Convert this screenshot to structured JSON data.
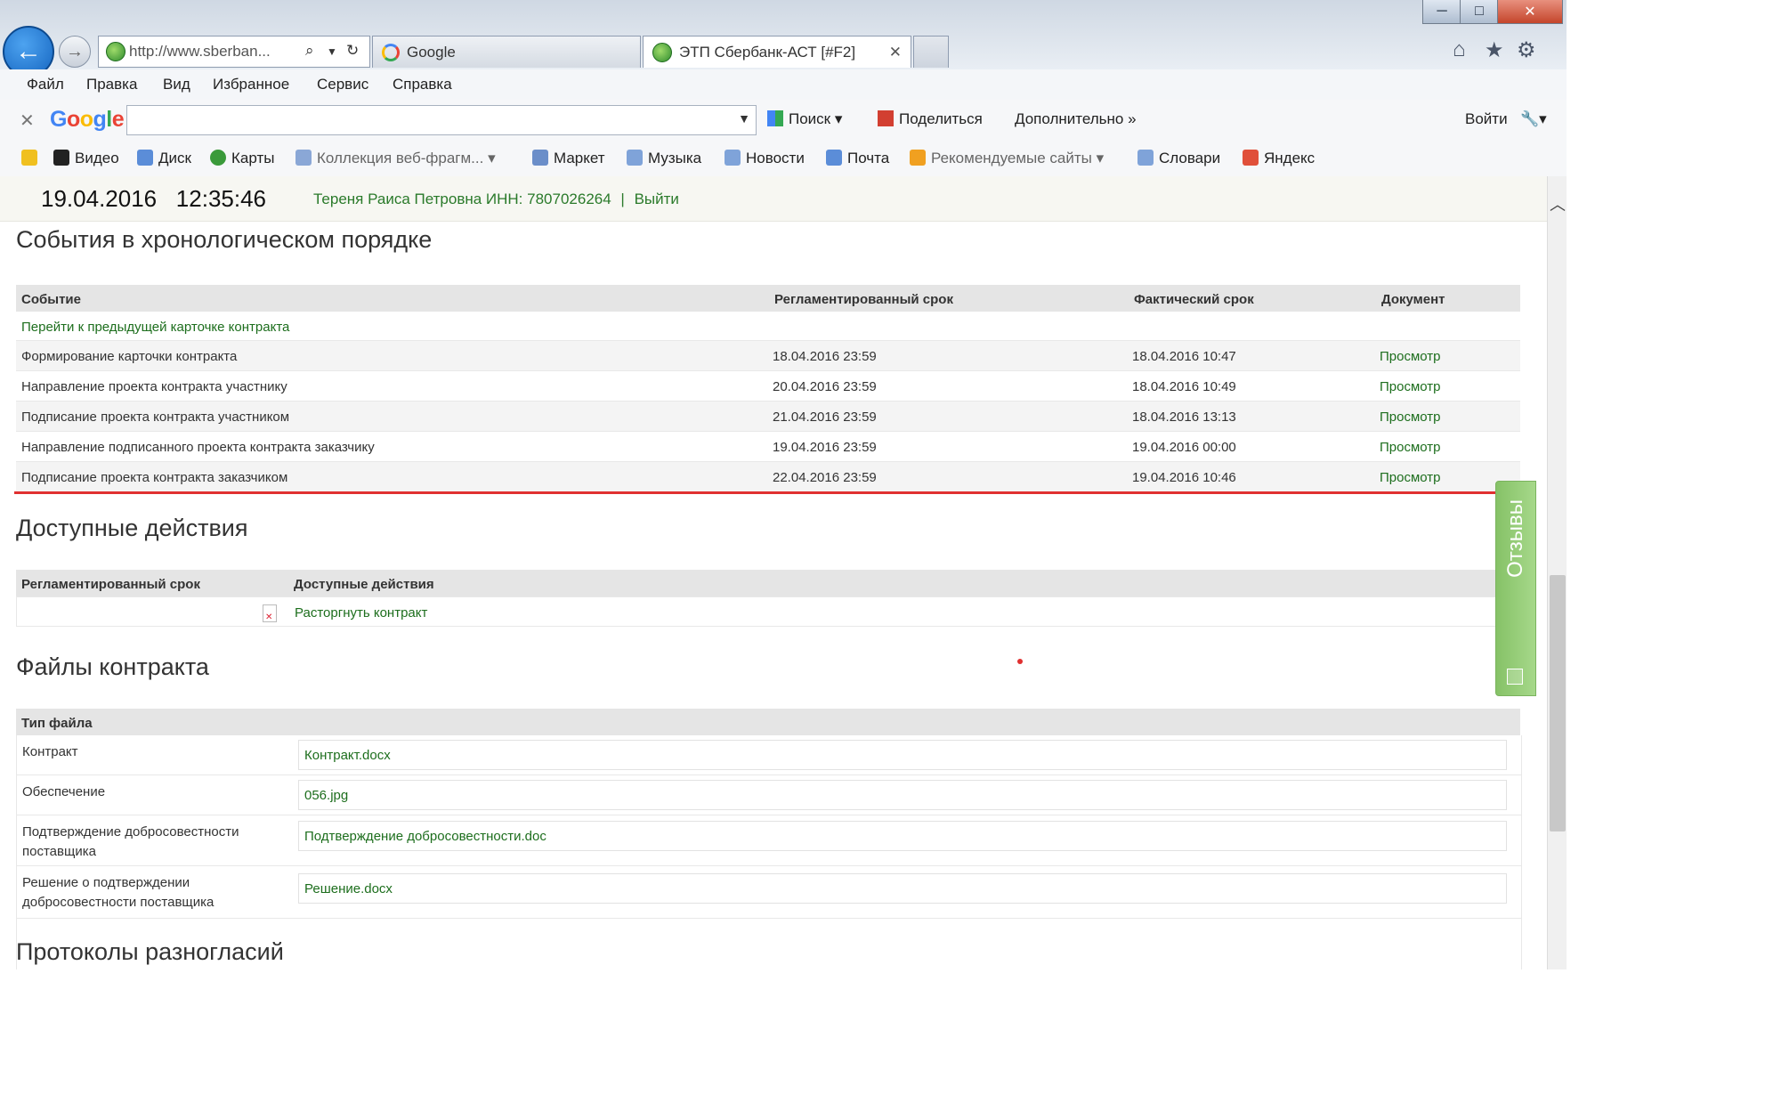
{
  "window": {
    "min": "─",
    "max": "□",
    "close": "✕"
  },
  "browser": {
    "address": "http://www.sberban...",
    "tabs": [
      {
        "label": "Google"
      },
      {
        "label": "ЭТП Сбербанк-АСТ [#F2]",
        "close": "✕"
      }
    ],
    "menu": [
      "Файл",
      "Правка",
      "Вид",
      "Избранное",
      "Сервис",
      "Справка"
    ],
    "google_bar": {
      "logo": "Google",
      "search_value": "",
      "search_btn": "Поиск",
      "share": "Поделиться",
      "more": "Дополнительно »",
      "login": "Войти"
    },
    "bookmarks": [
      "Видео",
      "Диск",
      "Карты",
      "Коллекция веб-фрагм...",
      "Маркет",
      "Музыка",
      "Новости",
      "Почта",
      "Рекомендуемые сайты",
      "Словари",
      "Яндекс"
    ]
  },
  "page": {
    "datetime": "19.04.2016   12:35:46",
    "user": "Тереня Раиса Петровна ИНН: 7807026264",
    "sep": "|",
    "logout": "Выйти",
    "events": {
      "title": "События в хронологическом порядке",
      "headers": [
        "Событие",
        "Регламентированный срок",
        "Фактический срок",
        "Документ"
      ],
      "prev_link": "Перейти к предыдущей карточке контракта",
      "rows": [
        {
          "event": "Формирование карточки контракта",
          "deadline": "18.04.2016 23:59",
          "actual": "18.04.2016 10:47",
          "doc": "Просмотр"
        },
        {
          "event": "Направление проекта контракта участнику",
          "deadline": "20.04.2016 23:59",
          "actual": "18.04.2016 10:49",
          "doc": "Просмотр"
        },
        {
          "event": "Подписание проекта контракта участником",
          "deadline": "21.04.2016 23:59",
          "actual": "18.04.2016 13:13",
          "doc": "Просмотр"
        },
        {
          "event": "Направление подписанного проекта контракта заказчику",
          "deadline": "19.04.2016 23:59",
          "actual": "19.04.2016 00:00",
          "doc": "Просмотр"
        },
        {
          "event": "Подписание проекта контракта заказчиком",
          "deadline": "22.04.2016 23:59",
          "actual": "19.04.2016 10:46",
          "doc": "Просмотр"
        }
      ]
    },
    "feedback": "Отзывы",
    "actions": {
      "title": "Доступные действия",
      "headers": [
        "Регламентированный срок",
        "Доступные действия"
      ],
      "action": "Расторгнуть контракт"
    },
    "files": {
      "title": "Файлы контракта",
      "header": "Тип файла",
      "rows": [
        {
          "type": "Контракт",
          "file": "Контракт.docx"
        },
        {
          "type": "Обеспечение",
          "file": "056.jpg"
        },
        {
          "type": "Подтверждение добросовестности\nпоставщика",
          "file": "Подтверждение добросовестности.doc"
        },
        {
          "type": "Решение о подтверждении\nдобросовестности поставщика",
          "file": "Решение.docx"
        }
      ]
    },
    "protocols_title": "Протоколы разногласий"
  },
  "colors": {
    "link": "#1d6e1d",
    "accent_red": "#e03030",
    "header_bg": "#e5e5e5"
  }
}
